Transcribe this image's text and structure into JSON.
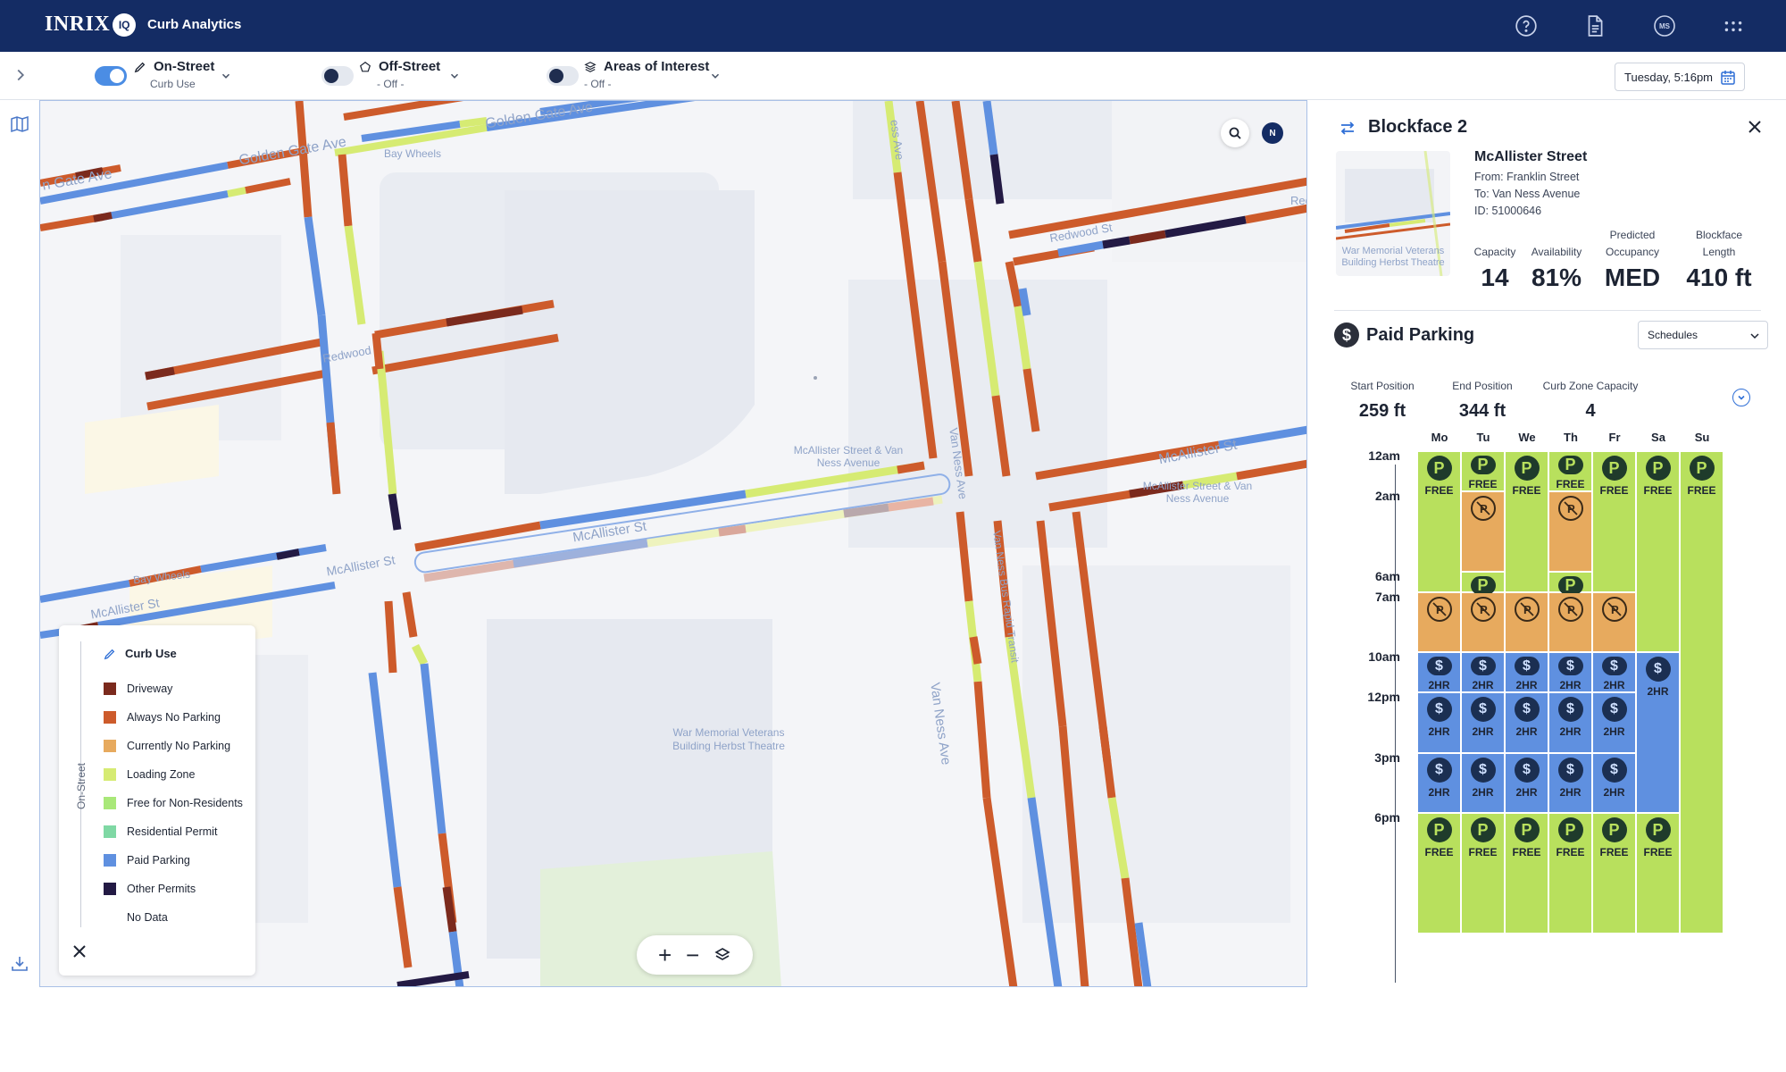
{
  "header": {
    "logo": "INRIX",
    "logo_badge": "IQ",
    "app_title": "Curb Analytics",
    "icons": [
      "help-icon",
      "document-icon",
      "user-avatar",
      "apps-grid-icon"
    ],
    "avatar_initials": "MS"
  },
  "filters": {
    "on_street": {
      "label": "On-Street",
      "sub": "Curb Use",
      "enabled": true
    },
    "off_street": {
      "label": "Off-Street",
      "sub": "- Off -",
      "enabled": false
    },
    "aoi": {
      "label": "Areas of Interest",
      "sub": "- Off -",
      "enabled": false
    },
    "date": "Tuesday, 5:16pm"
  },
  "map": {
    "labels": {
      "golden_gate_1": "Golden Gate Ave",
      "golden_gate_2": "Golden Gate Ave",
      "golden_gate_3": "n Gate Ave",
      "bay_wheels_1": "Bay Wheels",
      "bay_wheels_2": "Bay Wheels",
      "redwood_1": "Redwood",
      "redwood_2": "Redwood St",
      "mcallister_1": "McAllister St",
      "mcallister_2": "McAllister St",
      "mcallister_3": "McAllister St",
      "mcallister_4": "McAllister St",
      "van_ness_1": "Van Ness Ave",
      "van_ness_2": "Van Ness Bus Rapid Transit",
      "van_ness_3": "Van Ness Ave",
      "ness_ave": "ess Ave",
      "stop_1": "McAllister Street & Van Ness Avenue",
      "stop_2": "McAllister Street & Van Ness Avenue",
      "building": "War Memorial Veterans Building Herbst Theatre",
      "red_frag": "Red"
    },
    "compass": "N"
  },
  "legend": {
    "side_label": "On-Street",
    "title": "Curb Use",
    "items": [
      {
        "label": "Driveway",
        "color": "#7b2a1d"
      },
      {
        "label": "Always No Parking",
        "color": "#cd5b2b"
      },
      {
        "label": "Currently No Parking",
        "color": "#e7aa5e"
      },
      {
        "label": "Loading Zone",
        "color": "#d6eb73"
      },
      {
        "label": "Free for Non-Residents",
        "color": "#a9e879"
      },
      {
        "label": "Residential Permit",
        "color": "#7fd8a4"
      },
      {
        "label": "Paid Parking",
        "color": "#5f90e0"
      },
      {
        "label": "Other Permits",
        "color": "#231a44"
      },
      {
        "label": "No Data",
        "color": "#ffffff"
      }
    ]
  },
  "panel": {
    "title": "Blockface 2",
    "street": "McAllister Street",
    "from": "From: Franklin Street",
    "to": "To: Van Ness Avenue",
    "id": "ID: 51000646",
    "thumb_label": "War Memorial Veterans Building Herbst Theatre",
    "stats": [
      {
        "label": "Capacity",
        "value": "14"
      },
      {
        "label": "Availability",
        "value": "81%"
      },
      {
        "label": "Predicted Occupancy",
        "value": "MED"
      },
      {
        "label": "Blockface Length",
        "value": "410 ft"
      }
    ],
    "section": "Paid Parking",
    "section_icon": "$",
    "schedules_select": "Schedules",
    "positions": [
      {
        "label": "Start Position",
        "value": "259 ft"
      },
      {
        "label": "End Position",
        "value": "344 ft"
      },
      {
        "label": "Curb Zone Capacity",
        "value": "4"
      }
    ],
    "days": [
      "Mo",
      "Tu",
      "We",
      "Th",
      "Fr",
      "Sa",
      "Su"
    ],
    "times": [
      "12am",
      "2am",
      "6am",
      "7am",
      "10am",
      "12pm",
      "3pm",
      "6pm"
    ],
    "free": "FREE",
    "two_hr": "2HR",
    "p": "P",
    "dollar": "$"
  }
}
